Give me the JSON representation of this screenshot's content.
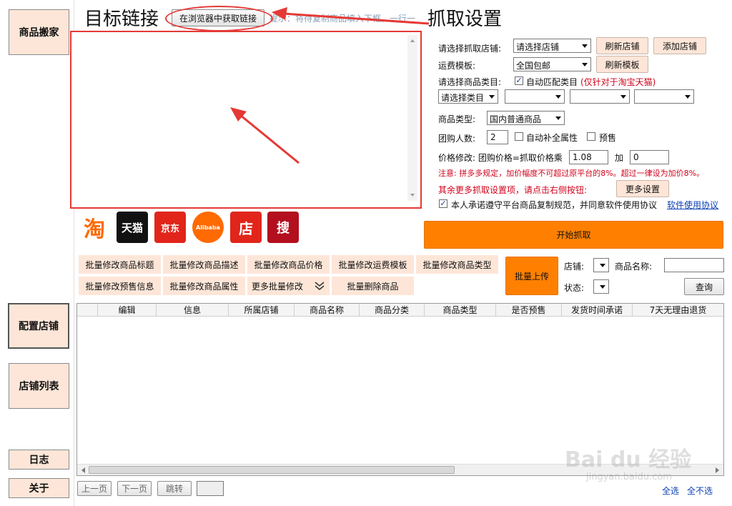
{
  "nav": {
    "move_goods": "商品搬家",
    "config_store": "配置店铺",
    "store_list": "店铺列表",
    "log": "日志",
    "about": "关于"
  },
  "target": {
    "title": "目标链接",
    "fetch_browser_btn": "在浏览器中获取链接",
    "hint": "提示：将待复制商品填入下框，一行一"
  },
  "settings": {
    "title": "抓取设置",
    "store_label": "请选择抓取店铺:",
    "store_select": "请选择店铺",
    "refresh_store": "刷新店铺",
    "add_store": "添加店铺",
    "shipping_label": "运费模板:",
    "shipping_select": "全国包邮",
    "refresh_template": "刷新模板",
    "category_label": "请选择商品类目:",
    "auto_match_label": "自动匹配类目",
    "auto_match_note": "(仅针对于淘宝天猫)",
    "category_select_1": "请选择类目",
    "goods_type_label": "商品类型:",
    "goods_type_select": "国内普通商品",
    "group_count_label": "团购人数:",
    "group_count_value": "2",
    "auto_attr_label": "自动补全属性",
    "presale_label": "预售",
    "price_label": "价格修改: 团购价格=抓取价格乘",
    "price_multiplier": "1.08",
    "plus_label": "加",
    "plus_value": "0",
    "notice": "注意: 拼多多规定，加价幅度不可超过原平台的8%。超过一律设为加价8%。",
    "more_notice": "其余更多抓取设置项，请点击右侧按钮:",
    "more_settings_btn": "更多设置",
    "agree_label": "本人承诺遵守平台商品复制规范，并同意软件使用协议",
    "agreement_link": "软件使用协议",
    "start_btn": "开始抓取"
  },
  "platforms": [
    "淘",
    "天猫",
    "京东",
    "Alibaba",
    "店",
    "搜"
  ],
  "toolbar": {
    "edit_title": "批量修改商品标题",
    "edit_desc": "批量修改商品描述",
    "edit_price": "批量修改商品价格",
    "edit_shipping": "批量修改运费模板",
    "edit_type": "批量修改商品类型",
    "edit_presale": "批量修改预售信息",
    "edit_attr": "批量修改商品属性",
    "more_edit": "更多批量修改",
    "delete": "批量删除商品",
    "upload": "批量上传",
    "store_label": "店铺:",
    "status_label": "状态:",
    "name_label": "商品名称:",
    "query_btn": "查询"
  },
  "table": {
    "columns": [
      "编辑",
      "信息",
      "所属店铺",
      "商品名称",
      "商品分类",
      "商品类型",
      "是否预售",
      "发货时间承诺",
      "7天无理由退货"
    ]
  },
  "pager": {
    "prev": "上一页",
    "next": "下一页",
    "jump": "跳转",
    "select_all": "全选",
    "select_none": "全不选"
  },
  "watermark": {
    "brand": "Bai du 经验",
    "url": "jingyan.baidu.com"
  }
}
